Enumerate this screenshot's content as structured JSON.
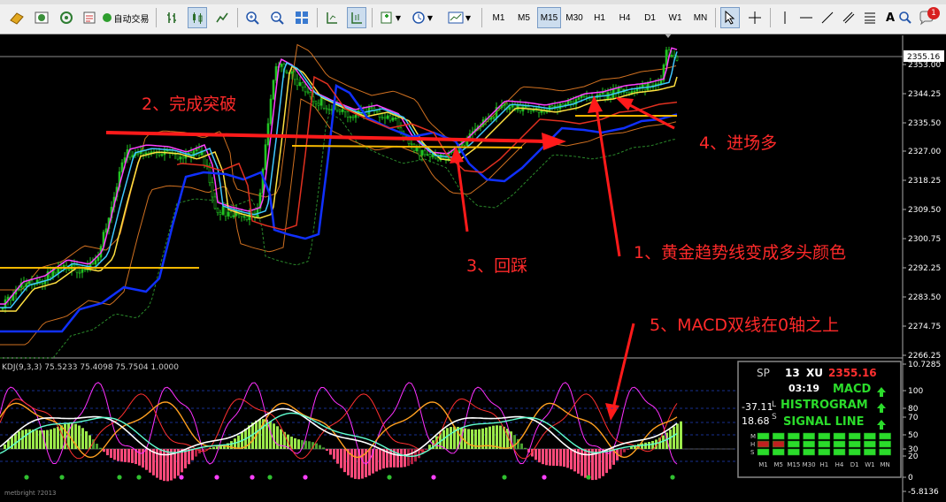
{
  "toolbar": {
    "autotrade_label": "自动交易",
    "timeframes": [
      "M1",
      "M5",
      "M15",
      "M30",
      "H1",
      "H4",
      "D1",
      "W1",
      "MN"
    ],
    "active_timeframe": "M15",
    "notification_count": "1"
  },
  "price_axis": {
    "current_price": "2355.16",
    "ticks": [
      "2353.00",
      "2344.25",
      "2335.50",
      "2327.00",
      "2318.25",
      "2309.50",
      "2300.75",
      "2292.25",
      "2283.50",
      "2274.75",
      "2266.25"
    ]
  },
  "annotations": {
    "a1": "1、黄金趋势线变成多头颜色",
    "a2": "2、完成突破",
    "a3": "3、回踩",
    "a4": "4、进场多",
    "a5": "5、MACD双线在0轴之上"
  },
  "indicator": {
    "label": "KDJ(9,3,3) 75.5233 75.4098 75.7504 1.0000",
    "axis_ticks": [
      "10.7285",
      "100",
      "80",
      "70",
      "50",
      "30",
      "20",
      "0",
      "-5.8136"
    ],
    "copyright": "metbright ?2013"
  },
  "signal_panel": {
    "sp_label": "SP",
    "sp_value": "13",
    "xu_label": "XU",
    "price": "2355.16",
    "time": "03:19",
    "left_top": "-37.11",
    "left_bottom": "18.68",
    "l_label": "L",
    "s_label": "S",
    "macd_label": "MACD",
    "histogram_label": "HISTROGRAM",
    "signal_label": "SIGNAL LINE",
    "row_labels": [
      "M",
      "H",
      "S"
    ],
    "timeframes": [
      "M1",
      "M5",
      "M15",
      "M30",
      "H1",
      "H4",
      "D1",
      "W1",
      "MN"
    ]
  },
  "colors": {
    "background": "#000000",
    "annotation_red": "#ff2a2a",
    "gold_line": "#f5b800",
    "blue_line": "#1030ff",
    "panel_green": "#2bdc2b",
    "up_arrow": "#2bdc2b"
  }
}
